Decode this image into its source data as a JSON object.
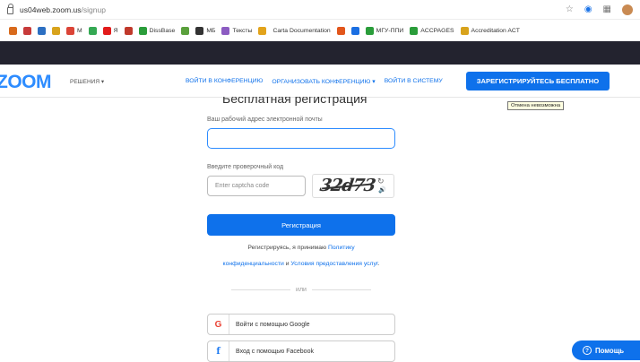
{
  "browser": {
    "url_host": "us04web.zoom.us",
    "url_path": "/signup",
    "bookmarks": [
      {
        "label": "",
        "color": "#d86a1c"
      },
      {
        "label": "",
        "color": "#c73a3a"
      },
      {
        "label": "",
        "color": "#2c6fc2"
      },
      {
        "label": "",
        "color": "#d8a31c"
      },
      {
        "label": "M",
        "color": "#db4437"
      },
      {
        "label": "",
        "color": "#34a853"
      },
      {
        "label": "Я",
        "color": "#e21b1b"
      },
      {
        "label": "",
        "color": "#c0392b"
      },
      {
        "label": "DissBase",
        "color": "#2a9d3a"
      },
      {
        "label": "",
        "color": "#5aa03c"
      },
      {
        "label": "МБ",
        "color": "#333333"
      },
      {
        "label": "Тексты",
        "color": "#8c5cc2"
      },
      {
        "label": "",
        "color": "#e2a31b"
      },
      {
        "label": "Carta Documentation",
        "color": ""
      },
      {
        "label": "",
        "color": "#e2561b"
      },
      {
        "label": "",
        "color": "#1b6fe2"
      },
      {
        "label": "МГУ-ППИ",
        "color": "#2a9d3a"
      },
      {
        "label": "ACCPAGES",
        "color": "#2a9d3a"
      },
      {
        "label": "Accreditation ACT",
        "color": "#d8a31c"
      }
    ]
  },
  "nav": {
    "logo": "ZOOM",
    "solutions": "РЕШЕНИЯ ▾",
    "join_meeting": "ВОЙТИ В КОНФЕРЕНЦИЮ",
    "host_meeting": "ОРГАНИЗОВАТЬ КОНФЕРЕНЦИЮ ▾",
    "sign_in": "ВОЙТИ В СИСТЕМУ",
    "signup_cta": "ЗАРЕГИСТРИРУЙТЕСЬ БЕСПЛАТНО"
  },
  "form": {
    "heading": "Бесплатная регистрация",
    "tooltip": "Отмена невозможна",
    "email_label": "Ваш рабочий адрес электронной почты",
    "email_value": "",
    "captcha_label": "Введите проверочный код",
    "captcha_placeholder": "Enter captcha code",
    "captcha_text": "32d73",
    "register_label": "Регистрация",
    "terms_prefix": "Регистрируясь, я принимаю",
    "terms_privacy_a": "Политику",
    "terms_privacy_b": "конфиденциальности",
    "terms_and": "и",
    "terms_service": "Условия предоставления услуг",
    "terms_dot": ".",
    "or": "или",
    "google_label": "Войти с помощью Google",
    "facebook_label": "Вход с помощью Facebook"
  },
  "help": {
    "label": "Помощь"
  }
}
